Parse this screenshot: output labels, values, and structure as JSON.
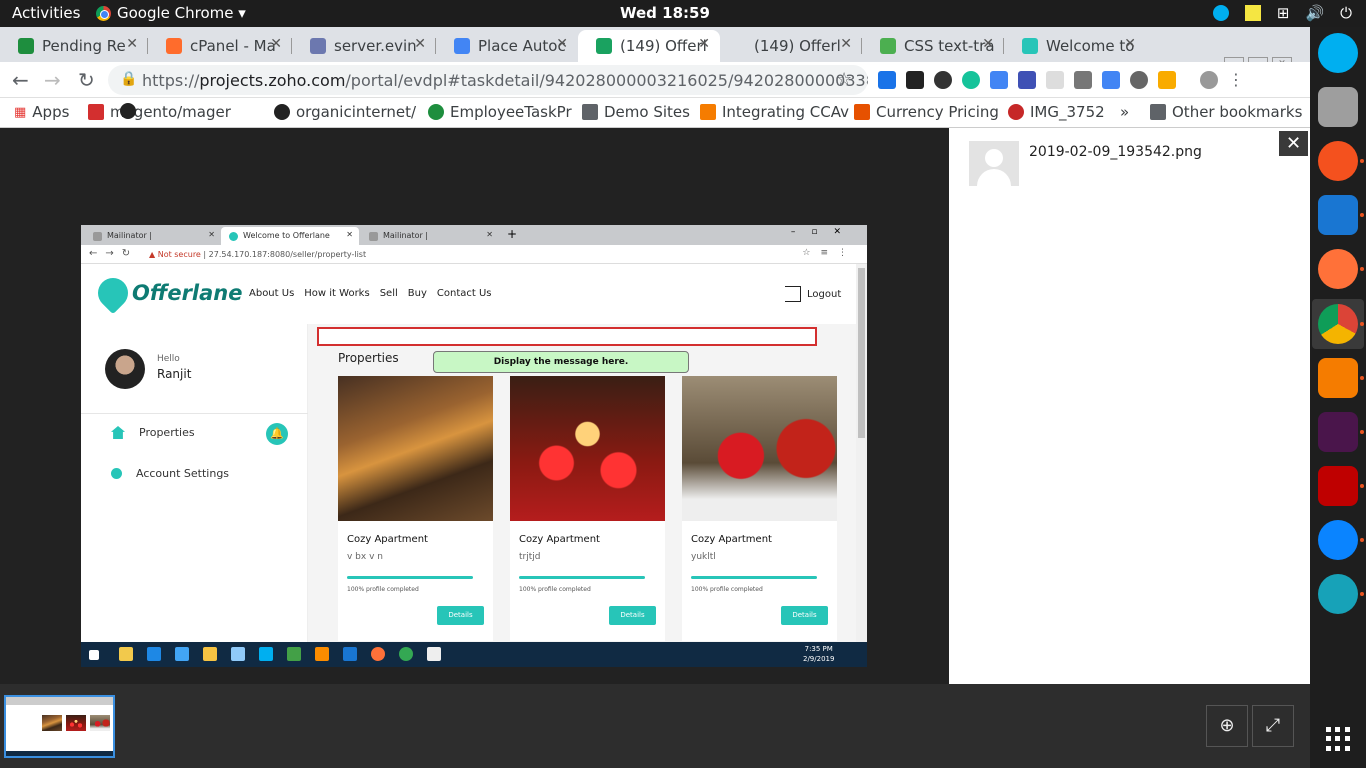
{
  "os": {
    "activities": "Activities",
    "app": "Google Chrome ▾",
    "clock": "Wed 18:59"
  },
  "tabs": [
    {
      "label": "Pending Re",
      "color": "#1e8e3e"
    },
    {
      "label": "cPanel - Ma",
      "color": "#ff6c2c"
    },
    {
      "label": "server.evin",
      "color": "#6c78af"
    },
    {
      "label": "Place Autoc",
      "color": "#4285f4"
    },
    {
      "label": "(149) Offerl",
      "color": "#1aa260"
    },
    {
      "label": "(149) Offerl",
      "color": "#cccccc"
    },
    {
      "label": "CSS text-tra",
      "color": "#4caf50"
    },
    {
      "label": "Welcome to",
      "color": "#27c5b8"
    }
  ],
  "address": {
    "prefix": "https://",
    "host": "projects.zoho.com",
    "path": "/portal/evdpl#taskdetail/942028000003216025/942028000003384039/94202..."
  },
  "bookmarks": [
    {
      "label": "Apps",
      "color": "#e53935"
    },
    {
      "label": "magento/mager",
      "color": "#d32f2f"
    },
    {
      "label": "organicinternet/",
      "color": "#222222"
    },
    {
      "label": "EmployeeTaskPr",
      "color": "#1e8e3e"
    },
    {
      "label": "Demo Sites",
      "color": "#5f6368"
    },
    {
      "label": "Integrating CCAv",
      "color": "#f57c00"
    },
    {
      "label": "Currency Pricing",
      "color": "#e65100"
    },
    {
      "label": "IMG_3752",
      "color": "#c62828"
    },
    {
      "label": "Other bookmarks",
      "color": "#5f6368"
    }
  ],
  "bookmarks_more": "»",
  "side": {
    "filename": "2019-02-09_193542.png",
    "close": "✕"
  },
  "inner": {
    "tabs": [
      "Mailinator |",
      "Welcome to Offerlane",
      "Mailinator |"
    ],
    "url_warning": "Not secure",
    "url": "27.54.170.187:8080/seller/property-list",
    "logo": "Offerlane",
    "menu": [
      "About Us",
      "How it Works",
      "Sell",
      "Buy",
      "Contact Us"
    ],
    "logout": "Logout",
    "hello": "Hello",
    "user": "Ranjit",
    "sidebar": [
      "Properties",
      "Account Settings"
    ],
    "properties_title": "Properties",
    "message": "Display the message here.",
    "cards": [
      {
        "title": "Cozy Apartment",
        "subtitle": "v bx v n",
        "progress": 1.0,
        "progress_text": "100% profile completed",
        "button": "Details",
        "image": "tiger"
      },
      {
        "title": "Cozy Apartment",
        "subtitle": "trjtjd",
        "progress": 1.0,
        "progress_text": "100% profile completed",
        "button": "Details",
        "image": "candles"
      },
      {
        "title": "Cozy Apartment",
        "subtitle": "yukltl",
        "progress": 1.0,
        "progress_text": "100% profile completed",
        "button": "Details",
        "image": "christmas-candle"
      }
    ],
    "taskbar_time": "7:35 PM",
    "taskbar_date": "2/9/2019"
  },
  "dock": [
    {
      "name": "skype",
      "color": "#00aff0"
    },
    {
      "name": "files",
      "color": "#9e9e9e"
    },
    {
      "name": "pen-app",
      "color": "#f4511e"
    },
    {
      "name": "vscode",
      "color": "#1976d2"
    },
    {
      "name": "firefox",
      "color": "#ff7139"
    },
    {
      "name": "chrome",
      "color": "#34a853"
    },
    {
      "name": "sublime",
      "color": "#f57c00"
    },
    {
      "name": "slack",
      "color": "#4a154b"
    },
    {
      "name": "filezilla",
      "color": "#bf0000"
    },
    {
      "name": "thunderbird",
      "color": "#0a84ff"
    },
    {
      "name": "gitkraken",
      "color": "#17a2b8"
    }
  ]
}
